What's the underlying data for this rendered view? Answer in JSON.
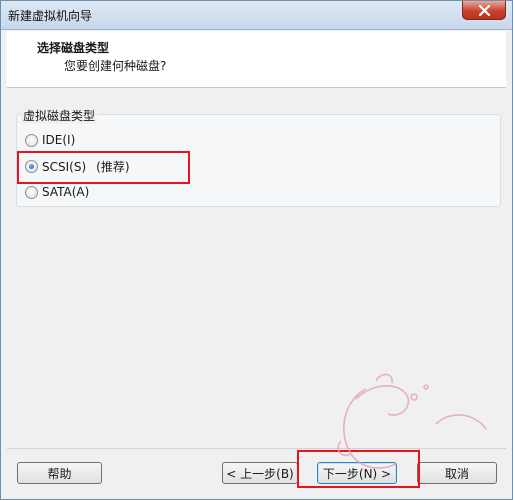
{
  "window": {
    "title": "新建虚拟机向导"
  },
  "header": {
    "title": "选择磁盘类型",
    "subtitle": "您要创建何种磁盘?"
  },
  "group": {
    "label": "虚拟磁盘类型"
  },
  "options": [
    {
      "label": "IDE(I)",
      "checked": false
    },
    {
      "label": "SCSI(S)",
      "checked": true,
      "note": "(推荐)"
    },
    {
      "label": "SATA(A)",
      "checked": false
    }
  ],
  "buttons": {
    "help": "帮助",
    "back": "< 上一步(B)",
    "next": "下一步(N) >",
    "cancel": "取消"
  },
  "colors": {
    "highlight": "#e8141c",
    "accent": "#1c5fb2"
  }
}
